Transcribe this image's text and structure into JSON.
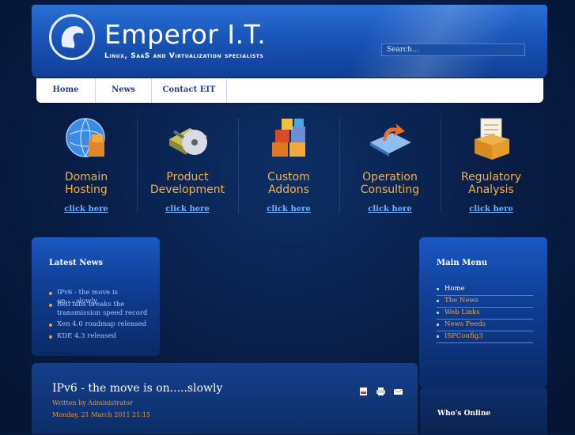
{
  "header": {
    "logo_text": "Emperor I.T.",
    "tagline": "Linux, SaaS and Virtualization specialists",
    "search_placeholder": "Search..."
  },
  "nav": {
    "items": [
      "Home",
      "News",
      "Contact EIT"
    ]
  },
  "services": [
    {
      "title_line1": "Domain",
      "title_line2": "Hosting",
      "link": "click here",
      "icon": "globe-boxes-icon"
    },
    {
      "title_line1": "Product",
      "title_line2": "Development",
      "link": "click here",
      "icon": "cd-tools-icon"
    },
    {
      "title_line1": "Custom",
      "title_line2": "Addons",
      "link": "click here",
      "icon": "blocks-icon"
    },
    {
      "title_line1": "Operation",
      "title_line2": "Consulting",
      "link": "click here",
      "icon": "arrow-cycle-icon"
    },
    {
      "title_line1": "Regulatory",
      "title_line2": "Analysis",
      "link": "click here",
      "icon": "file-box-icon"
    }
  ],
  "latest_news": {
    "title": "Latest News",
    "items": [
      "IPv6 - the move is on.....slowly",
      "Bell labs breaks the transmission speed record",
      "Xen 4.0 roadmap released",
      "KDE 4.3 released"
    ]
  },
  "main_menu": {
    "title": "Main Menu",
    "items": [
      "Home",
      "The News",
      "Web Links",
      "News Feeds",
      "ISPConfig3"
    ]
  },
  "article": {
    "title": "IPv6 - the move is on.....slowly",
    "author": "Written by Administrator",
    "date": "Monday, 21 March 2011 21:15"
  },
  "whos_online": {
    "title": "Who's Online"
  },
  "colors": {
    "accent_orange": "#f5b24a",
    "link_blue": "#6fb2ff",
    "background": "#081d45"
  }
}
